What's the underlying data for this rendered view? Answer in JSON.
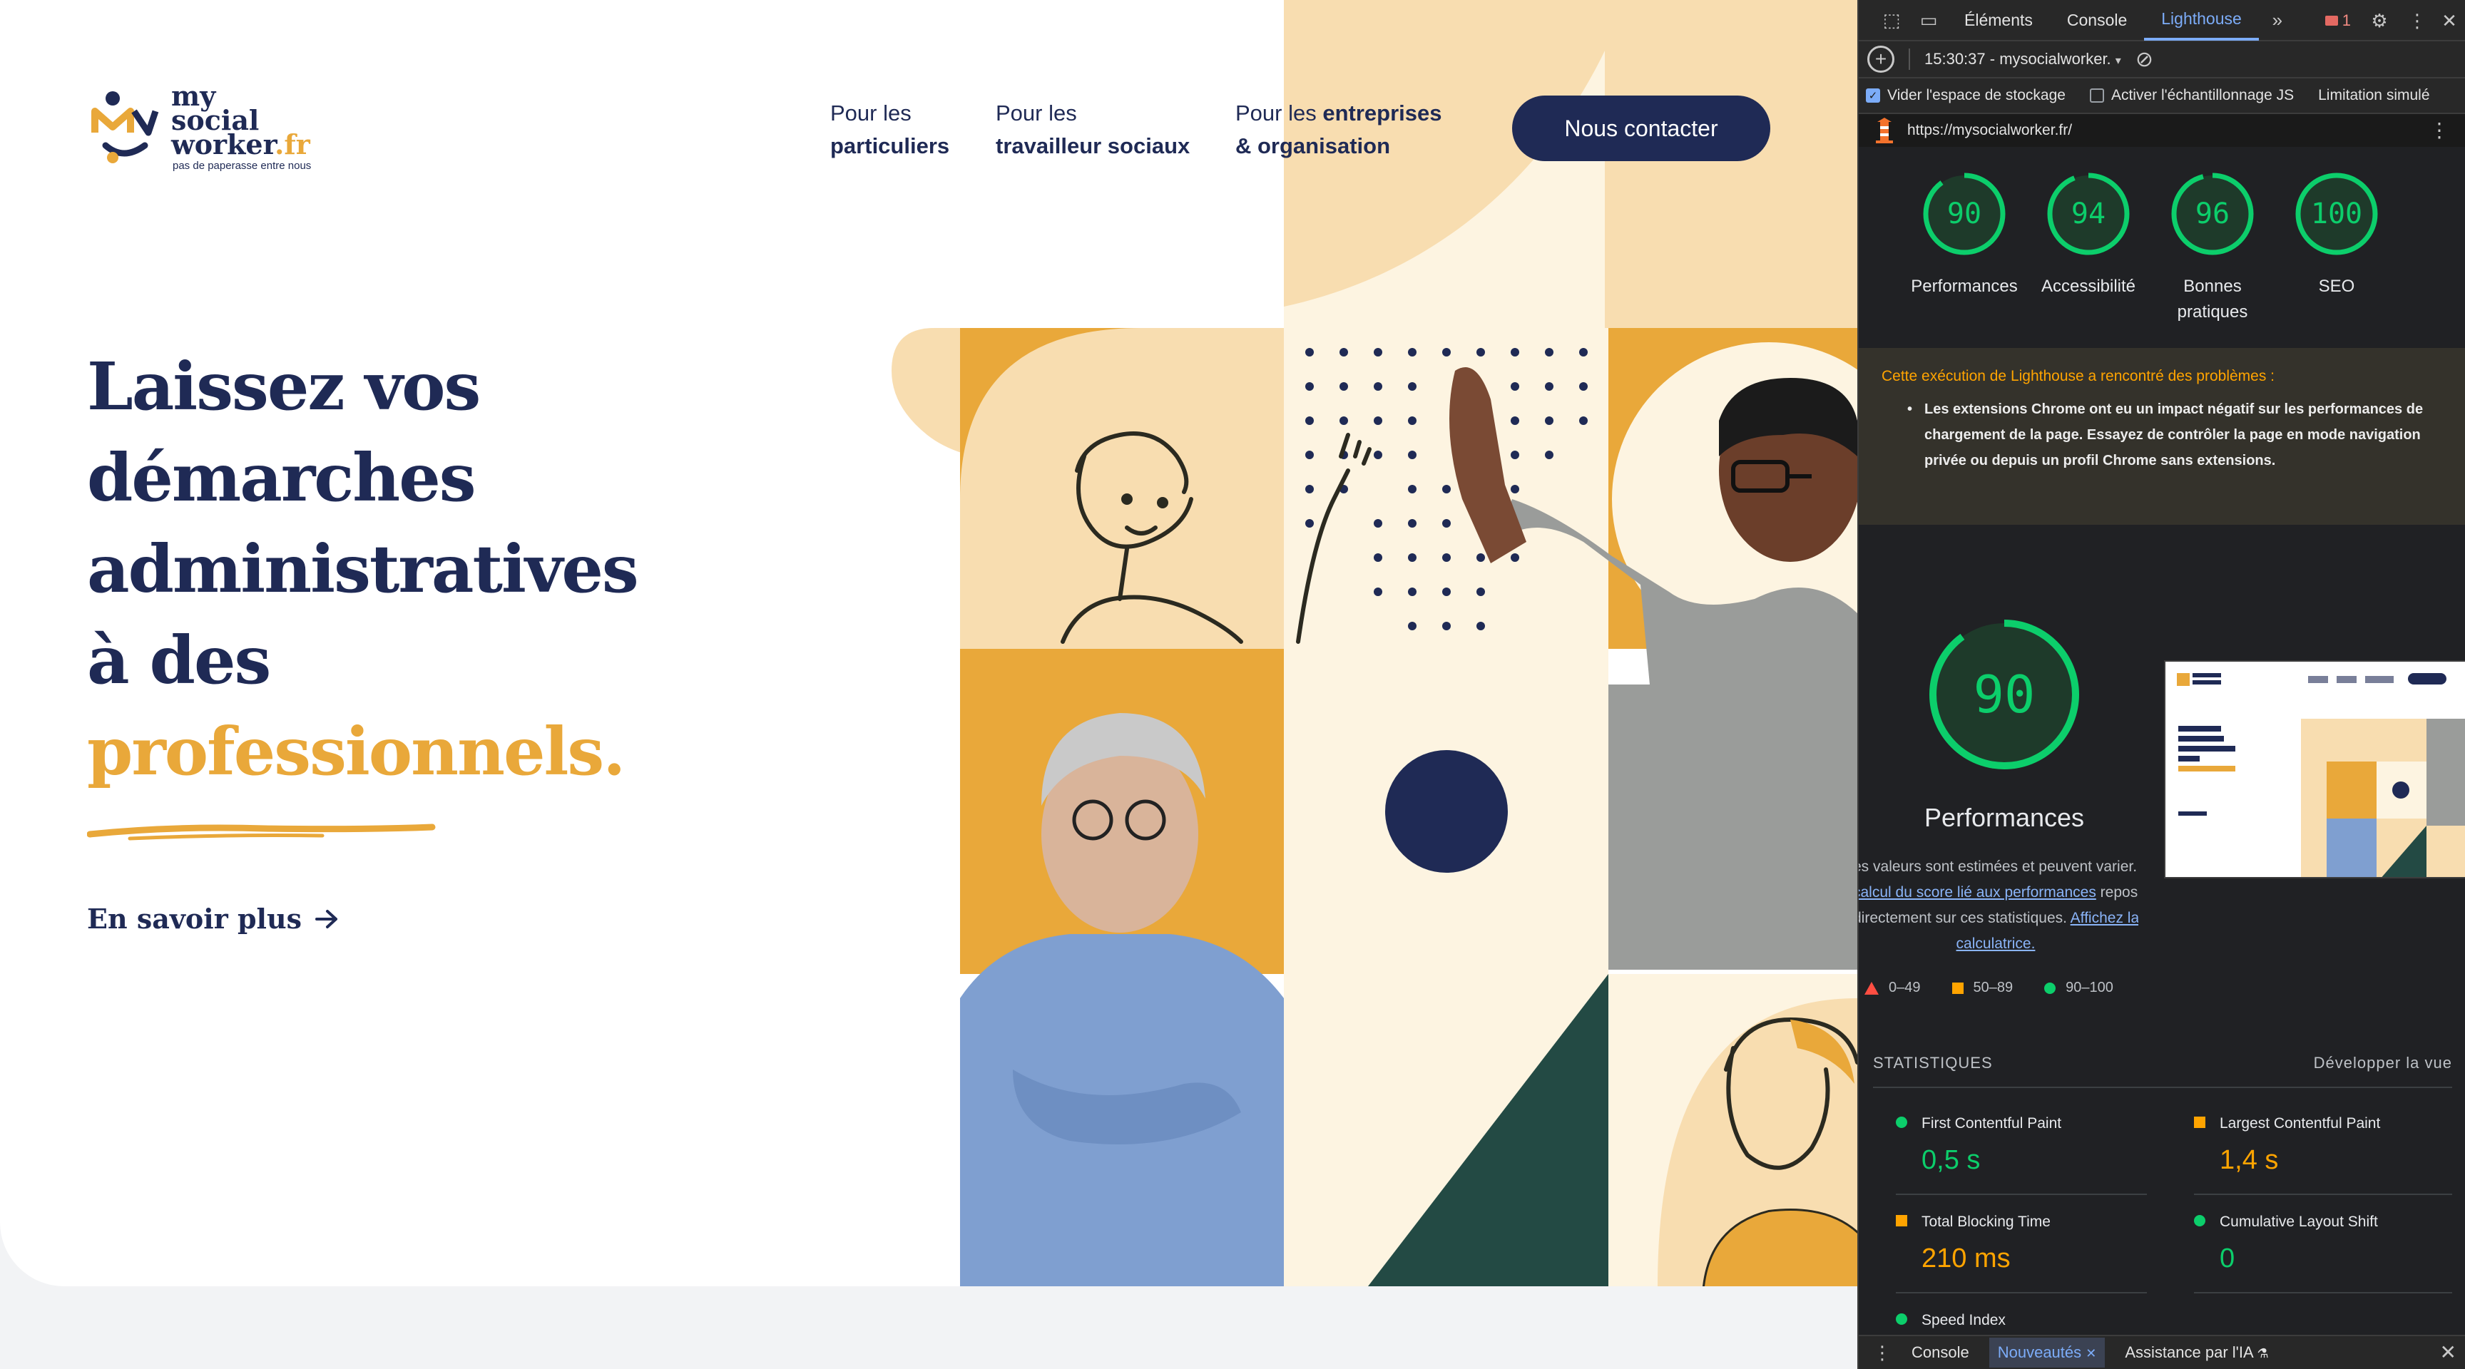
{
  "site": {
    "logo": {
      "line1": "my",
      "line2": "social",
      "line3": "worker",
      "tld": ".fr",
      "tagline": "pas de paperasse entre nous"
    },
    "nav": [
      {
        "prefix": "Pour les",
        "label": "particuliers"
      },
      {
        "prefix": "Pour les",
        "label": "travailleur sociaux"
      },
      {
        "prefix": "Pour les",
        "label": "entreprises",
        "suffix": "& organisation"
      }
    ],
    "cta_label": "Nous contacter",
    "hero": {
      "lines": [
        "Laissez vos",
        "démarches",
        "administratives",
        "à des"
      ],
      "accent": "professionnels."
    },
    "learn_more": "En savoir plus",
    "colors": {
      "navy": "#1f2a55",
      "gold": "#e9a83a",
      "peach": "#f8ddb0",
      "cream": "#fdf4e1",
      "green": "#234a44"
    }
  },
  "devtools": {
    "tabs": [
      "Éléments",
      "Console",
      "Lighthouse"
    ],
    "active_tab": "Lighthouse",
    "error_count": "1",
    "report_selector": "15:30:37 - mysocialworker.",
    "options": [
      {
        "label": "Vider l'espace de stockage",
        "checked": true
      },
      {
        "label": "Activer l'échantillonnage JS",
        "checked": false
      },
      {
        "label": "Limitation simulé",
        "checked": null
      }
    ],
    "url": "https://mysocialworker.fr/",
    "gauges": [
      {
        "score": "90",
        "label": "Performances",
        "value": 90
      },
      {
        "score": "94",
        "label": "Accessibilité",
        "value": 94
      },
      {
        "score": "96",
        "label": "Bonnes pratiques",
        "value": 96
      },
      {
        "score": "100",
        "label": "SEO",
        "value": 100
      }
    ],
    "warning": {
      "title": "Cette exécution de Lighthouse a rencontré des problèmes :",
      "item": "Les extensions Chrome ont eu un impact négatif sur les performances de chargement de la page. Essayez de contrôler la page en mode navigation privée ou depuis un profil Chrome sans extensions."
    },
    "performance": {
      "score": "90",
      "value": 90,
      "label": "Performances",
      "desc_1": "es valeurs sont estimées et peuvent varier. Le",
      "desc_link1": "calcul du score lié aux performances",
      "desc_2": " repose",
      "desc_3": "directement sur ces statistiques. ",
      "desc_link2": "Affichez la",
      "desc_link3": "calculatrice."
    },
    "legend": [
      {
        "shape": "triangle",
        "range": "0–49"
      },
      {
        "shape": "square",
        "range": "50–89"
      },
      {
        "shape": "circle",
        "range": "90–100"
      }
    ],
    "stats_title": "STATISTIQUES",
    "expand_view": "Développer la vue",
    "metrics": [
      {
        "name": "First Contentful Paint",
        "value": "0,5 s",
        "status": "good"
      },
      {
        "name": "Largest Contentful Paint",
        "value": "1,4 s",
        "status": "average"
      },
      {
        "name": "Total Blocking Time",
        "value": "210 ms",
        "status": "average"
      },
      {
        "name": "Cumulative Layout Shift",
        "value": "0",
        "status": "good"
      },
      {
        "name": "Speed Index",
        "value": "",
        "status": "good"
      }
    ],
    "drawer_tabs": [
      "Console",
      "Nouveautés",
      "Assistance par l'IA"
    ],
    "drawer_active": "Nouveautés"
  }
}
